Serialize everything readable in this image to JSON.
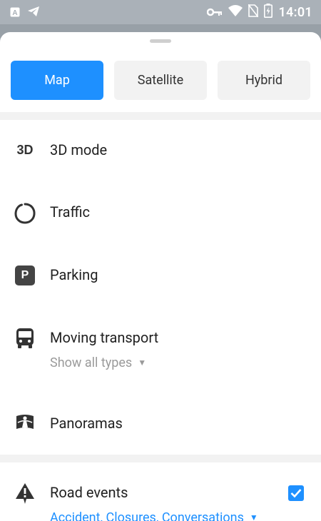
{
  "status_bar": {
    "time": "14:01",
    "left_icons": [
      "a-box-icon",
      "telegram-icon"
    ],
    "right_icons": [
      "key-icon",
      "wifi-icon",
      "no-sim-icon",
      "battery-charging-icon"
    ]
  },
  "map_types": {
    "items": [
      {
        "label": "Map",
        "active": true
      },
      {
        "label": "Satellite",
        "active": false
      },
      {
        "label": "Hybrid",
        "active": false
      }
    ]
  },
  "layers": [
    {
      "label": "3D mode",
      "icon": "3d-icon",
      "icon_text": "3D"
    },
    {
      "label": "Traffic",
      "icon": "traffic-ring-icon"
    },
    {
      "label": "Parking",
      "icon": "parking-icon",
      "icon_text": "P"
    },
    {
      "label": "Moving transport",
      "icon": "bus-icon",
      "sub": "Show all types"
    },
    {
      "label": "Panoramas",
      "icon": "panorama-icon"
    }
  ],
  "road_events": {
    "label": "Road events",
    "icon": "warning-icon",
    "sub": "Accident, Closures, Conversations",
    "checked": true
  },
  "colors": {
    "accent": "#1e90ff",
    "status_bar": "#aab1b8",
    "secondary_text": "#9a9a9a"
  }
}
